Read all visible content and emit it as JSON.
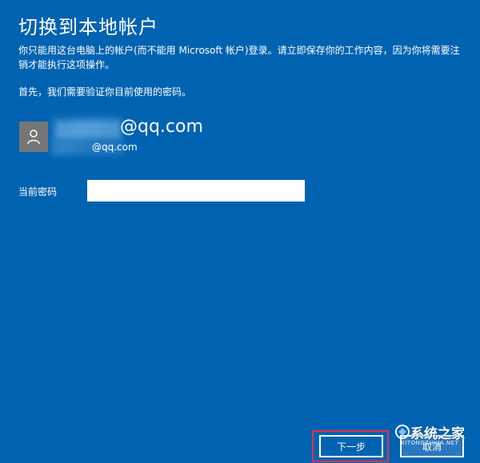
{
  "page": {
    "title": "切换到本地帐户",
    "description": "你只能用这台电脑上的帐户(而不能用 Microsoft 帐户)登录。请立即保存你的工作内容，因为你将需要注销才能执行这项操作。",
    "verify_text": "首先，我们需要验证你目前使用的密码。"
  },
  "account": {
    "email_main": "@qq.com",
    "email_sub": "@qq.com",
    "avatar_icon": "user-icon"
  },
  "form": {
    "password_label": "当前密码",
    "password_value": ""
  },
  "buttons": {
    "next_label": "下一步",
    "cancel_label": "取消"
  },
  "watermark": {
    "text": "系统之家",
    "url": "XITONGZHIJIA.NET"
  },
  "colors": {
    "background": "#0063b1",
    "avatar_bg": "#767676",
    "highlight": "#e0304a"
  }
}
